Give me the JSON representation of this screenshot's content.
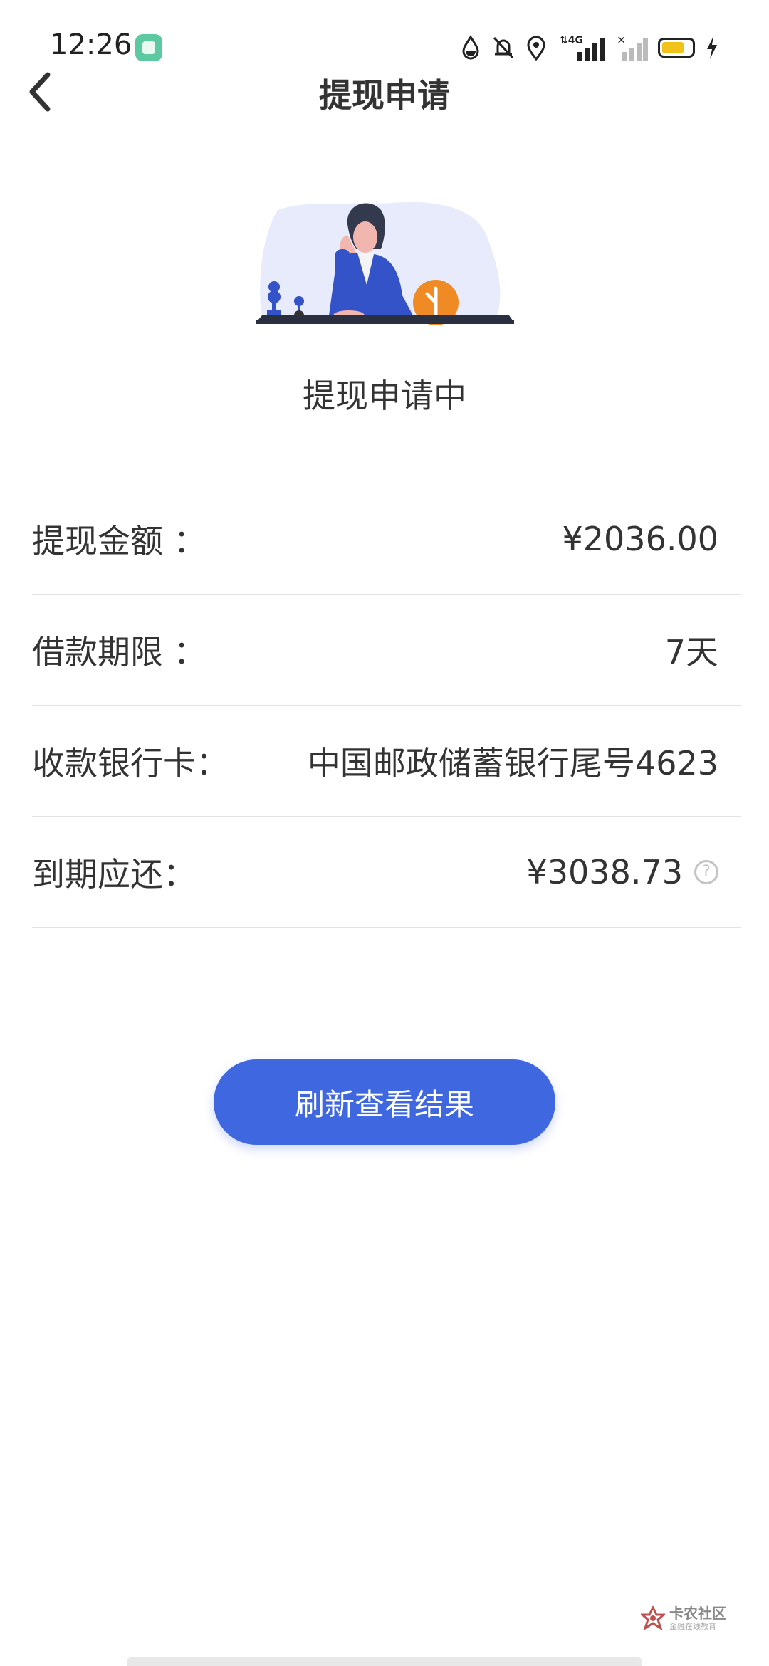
{
  "status_bar": {
    "time": "12:26",
    "network": "4G",
    "battery_color": "#f0c21a"
  },
  "header": {
    "title": "提现申请",
    "back_icon": "chevron-left-icon"
  },
  "status": {
    "text": "提现申请中"
  },
  "details": [
    {
      "label": "提现金额 ：",
      "value": "¥2036.00"
    },
    {
      "label": "借款期限 ：",
      "value": "7天"
    },
    {
      "label": "收款银行卡：",
      "value": "中国邮政储蓄银行尾号4623"
    },
    {
      "label": "到期应还：",
      "value": "¥3038.73",
      "help_icon": "?"
    }
  ],
  "actions": {
    "refresh_label": "刷新查看结果"
  },
  "watermark": {
    "title": "卡农社区",
    "subtitle": "金融在线教育"
  },
  "colors": {
    "accent": "#3f67e0",
    "text": "#333333",
    "divider": "#e2e2e2"
  }
}
